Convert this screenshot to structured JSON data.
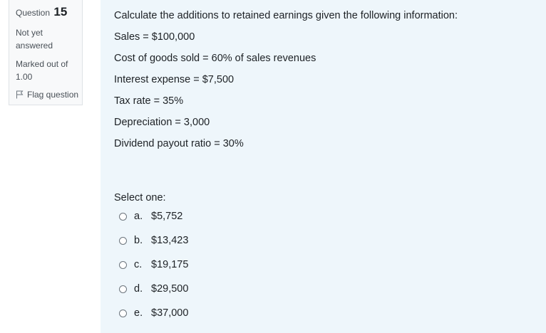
{
  "info": {
    "question_label": "Question",
    "question_number": "15",
    "state": "Not yet answered",
    "grade": "Marked out of 1.00",
    "flag_label": "Flag question"
  },
  "question": {
    "lines": [
      "Calculate the additions to retained earnings given the following information:",
      "Sales = $100,000",
      "Cost of goods sold = 60% of sales revenues",
      "Interest expense = $7,500",
      "Tax rate = 35%",
      "Depreciation = 3,000",
      "Dividend payout ratio = 30%"
    ],
    "prompt": "Select one:"
  },
  "options": [
    {
      "letter": "a.",
      "text": "$5,752"
    },
    {
      "letter": "b.",
      "text": "$13,423"
    },
    {
      "letter": "c.",
      "text": "$19,175"
    },
    {
      "letter": "d.",
      "text": "$29,500"
    },
    {
      "letter": "e.",
      "text": "$37,000"
    }
  ]
}
